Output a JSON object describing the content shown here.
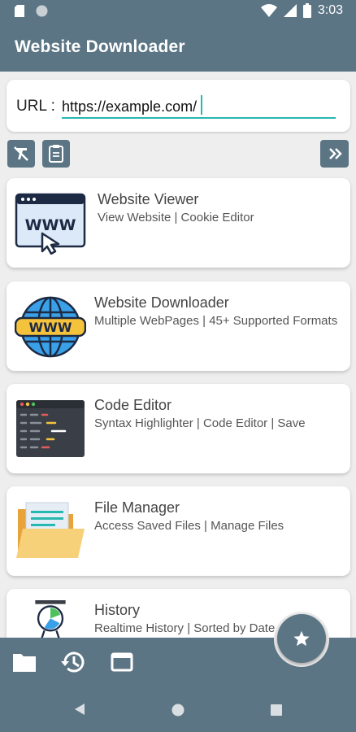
{
  "status_bar": {
    "time": "3:03",
    "icons": [
      "sd-card-icon",
      "circle-icon",
      "wifi-icon",
      "signal-icon",
      "battery-icon"
    ]
  },
  "app_bar": {
    "title": "Website Downloader"
  },
  "url_bar": {
    "label": "URL :",
    "value": "https://example.com/",
    "placeholder": ""
  },
  "toolbar": {
    "icons": [
      "clear-format-icon",
      "clipboard-icon",
      "double-chevron-right-icon"
    ]
  },
  "cards": [
    {
      "title": "Website Viewer",
      "subtitle": "View Website | Cookie Editor",
      "icon": "browser-www-icon"
    },
    {
      "title": "Website Downloader",
      "subtitle": "Multiple WebPages | 45+ Supported Formats",
      "icon": "globe-www-icon"
    },
    {
      "title": "Code Editor",
      "subtitle": "Syntax Highlighter | Code Editor | Save",
      "icon": "code-window-icon"
    },
    {
      "title": "File Manager",
      "subtitle": "Access Saved Files | Manage Files",
      "icon": "folder-files-icon"
    },
    {
      "title": "History",
      "subtitle": "Realtime History | Sorted by Date",
      "icon": "presentation-chart-icon"
    }
  ],
  "bottom_bar": {
    "icons": [
      "folder-icon",
      "history-icon",
      "window-icon"
    ]
  },
  "fab": {
    "icon": "star-icon"
  },
  "nav": {
    "icons": [
      "back-icon",
      "home-icon",
      "recents-icon"
    ]
  },
  "colors": {
    "primary": "#5c7585",
    "accent": "#27b8b0",
    "background": "#eeeeee",
    "card": "#ffffff"
  }
}
